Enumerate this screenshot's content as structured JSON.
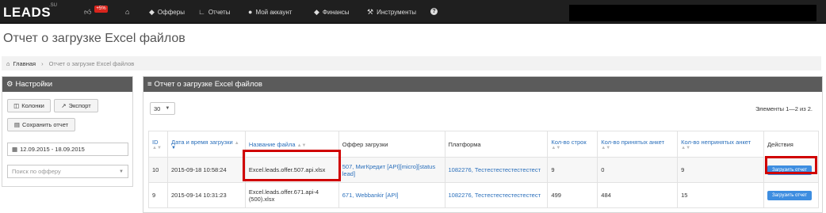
{
  "navbar": {
    "logo": "LEADS",
    "logo_sup": ".SU",
    "badge": "+5%",
    "items": [
      {
        "label": "Офферы",
        "icon": "tag-icon"
      },
      {
        "label": "Отчеты",
        "icon": "chart-icon"
      },
      {
        "label": "Мой аккаунт",
        "icon": "user-icon"
      },
      {
        "label": "Финансы",
        "icon": "tag-icon"
      },
      {
        "label": "Инструменты",
        "icon": "wrench-icon"
      }
    ]
  },
  "page": {
    "title": "Отчет о загрузке Excel файлов"
  },
  "breadcrumb": {
    "home": "Главная",
    "current": "Отчет о загрузке Excel файлов"
  },
  "settings": {
    "title": "Настройки",
    "columns_button": "Колонки",
    "export_button": "Экспорт",
    "save_report_button": "Сохранить отчет",
    "date_range": "12.09.2015 - 18.09.2015",
    "offer_search_placeholder": "Поиск по офферу"
  },
  "report": {
    "title": "Отчет о загрузке Excel файлов",
    "page_size": "30",
    "elements_info": "Элементы 1—2 из 2.",
    "columns": [
      "ID",
      "Дата и время загрузки",
      "Название файла",
      "Оффер загрузки",
      "Платформа",
      "Кол-во строк",
      "Кол-во принятых анкет",
      "Кол-во непринятых анкет",
      "Действия"
    ],
    "rows": [
      {
        "id": "10",
        "datetime": "2015-09-18 10:58:24",
        "filename": "Excel.leads.offer.507.api.xlsx",
        "offer": "507, МигКредит [API][micro][status lead]",
        "platform": "1082276, Тестестестестестестест",
        "rows_count": "9",
        "accepted": "0",
        "rejected": "9",
        "action": "Загрузить отчет"
      },
      {
        "id": "9",
        "datetime": "2015-09-14 10:31:23",
        "filename": "Excel.leads.offer.671.api-4 (500).xlsx",
        "offer": "671, Webbankir [API]",
        "platform": "1082276, Тестестестестестестест",
        "rows_count": "499",
        "accepted": "484",
        "rejected": "15",
        "action": "Загрузить отчет"
      }
    ]
  },
  "colors": {
    "navbar": "#1f1f1f",
    "panel_header": "#5b5b5b",
    "link": "#2a6fbb",
    "action_button": "#3d8de0",
    "highlight": "#d00000",
    "badge": "#d9251d"
  }
}
